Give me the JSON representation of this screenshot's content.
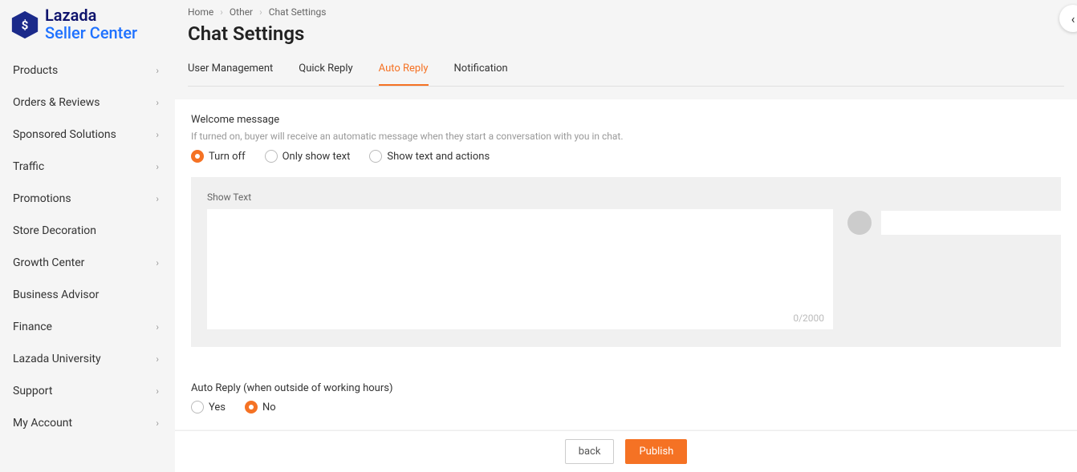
{
  "logo": {
    "line1": "Lazada",
    "line2": "Seller Center"
  },
  "sidebar": {
    "items": [
      {
        "label": "Products",
        "chev": true
      },
      {
        "label": "Orders & Reviews",
        "chev": true
      },
      {
        "label": "Sponsored Solutions",
        "chev": true
      },
      {
        "label": "Traffic",
        "chev": true
      },
      {
        "label": "Promotions",
        "chev": true
      },
      {
        "label": "Store Decoration",
        "chev": false
      },
      {
        "label": "Growth Center",
        "chev": true
      },
      {
        "label": "Business Advisor",
        "chev": false
      },
      {
        "label": "Finance",
        "chev": true
      },
      {
        "label": "Lazada University",
        "chev": true
      },
      {
        "label": "Support",
        "chev": true
      },
      {
        "label": "My Account",
        "chev": true
      }
    ]
  },
  "breadcrumb": {
    "home": "Home",
    "mid": "Other",
    "cur": "Chat Settings"
  },
  "page_title": "Chat Settings",
  "tabs": [
    {
      "label": "User Management",
      "active": false
    },
    {
      "label": "Quick Reply",
      "active": false
    },
    {
      "label": "Auto Reply",
      "active": true
    },
    {
      "label": "Notification",
      "active": false
    }
  ],
  "welcome": {
    "title": "Welcome message",
    "desc": "If turned on, buyer will receive an automatic message when they start a conversation with you in chat.",
    "options": [
      {
        "label": "Turn off",
        "checked": true
      },
      {
        "label": "Only show text",
        "checked": false
      },
      {
        "label": "Show text and actions",
        "checked": false
      }
    ],
    "show_text_label": "Show Text",
    "counter": "0/2000"
  },
  "auto_reply": {
    "title": "Auto Reply (when outside of working hours)",
    "options": [
      {
        "label": "Yes",
        "checked": false
      },
      {
        "label": "No",
        "checked": true
      }
    ]
  },
  "buttons": {
    "back": "back",
    "publish": "Publish"
  }
}
